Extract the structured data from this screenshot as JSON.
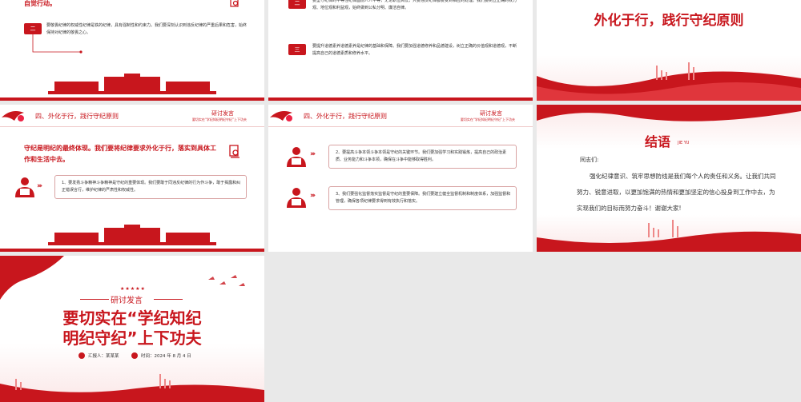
{
  "slide1": {
    "partial_lead": "自觉行动。",
    "item_num": "二",
    "item_text": "要敬畏纪律的权威性纪律是铁的纪律，具有强制性和约束力。我们要深刻认识到违反纪律的严重后果和危害，始终保持对纪律的敬畏之心。"
  },
  "slide2": {
    "item1_num": "二",
    "item1_text": "要坚守纪律的平等性纪律面前人人平等，无论职位高低，只要违反纪律都要受到相应的处理。我们要树立正确的权力观、地位观和利益观，始终做到公私分明、廉洁自律。",
    "item2_num": "三",
    "item2_text": "要提升道德素养道德素养是纪律的基础和保障。我们要加强道德修养和品德建设，树立正确的价值观和道德观，不断提高自己的道德素质和修养水平。"
  },
  "slide3": {
    "title": "外化于行，践行守纪原则"
  },
  "slide4": {
    "section": "四、外化于行，践行守纪原则",
    "right_title": "研讨发言",
    "right_sub": "要切实在“学纪知纪明纪守纪”上下功夫",
    "lead": "守纪是明纪的最终体现。我们要将纪律要求外化于行，落实到具体工作和生活中去。",
    "card_text": "1、要发扬斗争精神斗争精神是守纪的重要体现。我们要敢于同违反纪律的行为作斗争，敢于揭露和纠正错误言行，维护纪律的严肃性和权威性。"
  },
  "slide5": {
    "section": "四、外化于行，践行守纪原则",
    "right_title": "研讨发言",
    "right_sub": "要切实在“学纪知纪明纪守纪”上下功夫",
    "card1_text": "2、要提高斗争本领斗争本领是守纪的关键环节。我们要加强学习和实践锻炼，提高自己的政治素质、业务能力和斗争本领，确保在斗争中能够取得胜利。",
    "card2_text": "3、我们要强化监督落实监督是守纪的重要保障。我们要建立健全监督机制和制度体系，加强监督和管理，确保各项纪律要求得到有效执行和落实。"
  },
  "slide6": {
    "title": "结语",
    "subtitle": "JIE YU",
    "greeting": "同志们:",
    "body": "强化纪律意识、筑牢思想防线是我们每个人的责任和义务。让我们共同努力、锐意进取，以更加饱满的热情和更加坚定的信心投身到工作中去，为实现我们的目标而努力奋斗！谢谢大家!"
  },
  "slide7": {
    "stars": "★★★★★",
    "tag": "研讨发言",
    "title_line1": "要切实在“学纪知纪",
    "title_line2": "明纪守纪”上下功夫",
    "reporter_label": "汇报人：某某某",
    "date_label": "时间：2024 年 8 月 4 日"
  },
  "colors": {
    "accent": "#c8161d",
    "border": "#d9a3a3"
  }
}
